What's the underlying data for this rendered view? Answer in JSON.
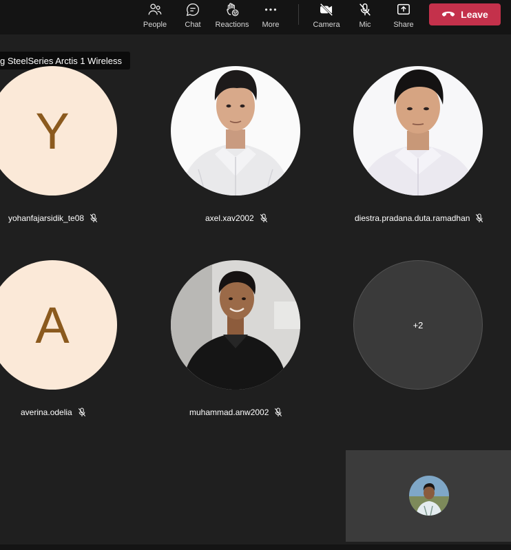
{
  "toolbar": {
    "people": "People",
    "chat": "Chat",
    "reactions": "Reactions",
    "more": "More",
    "camera": "Camera",
    "mic": "Mic",
    "share": "Share",
    "leave": "Leave"
  },
  "tooltip": "g SteelSeries Arctis 1 Wireless",
  "participants": [
    {
      "name": "yohanfajarsidik_te08",
      "initial": "Y"
    },
    {
      "name": "axel.xav2002"
    },
    {
      "name": "diestra.pradana.duta.ramadhan"
    },
    {
      "name": "averina.odelia",
      "initial": "A"
    },
    {
      "name": "muhammad.anw2002"
    }
  ],
  "overflow": "+2",
  "colors": {
    "leave": "#c4314b",
    "background": "#1f1f1f",
    "initial_avatar_bg": "#fbe9d8",
    "initial_avatar_text": "#8b5a1e"
  },
  "icons": [
    "people-icon",
    "chat-icon",
    "reactions-icon",
    "more-icon",
    "camera-off-icon",
    "mic-off-icon",
    "share-icon",
    "phone-hangup-icon"
  ]
}
